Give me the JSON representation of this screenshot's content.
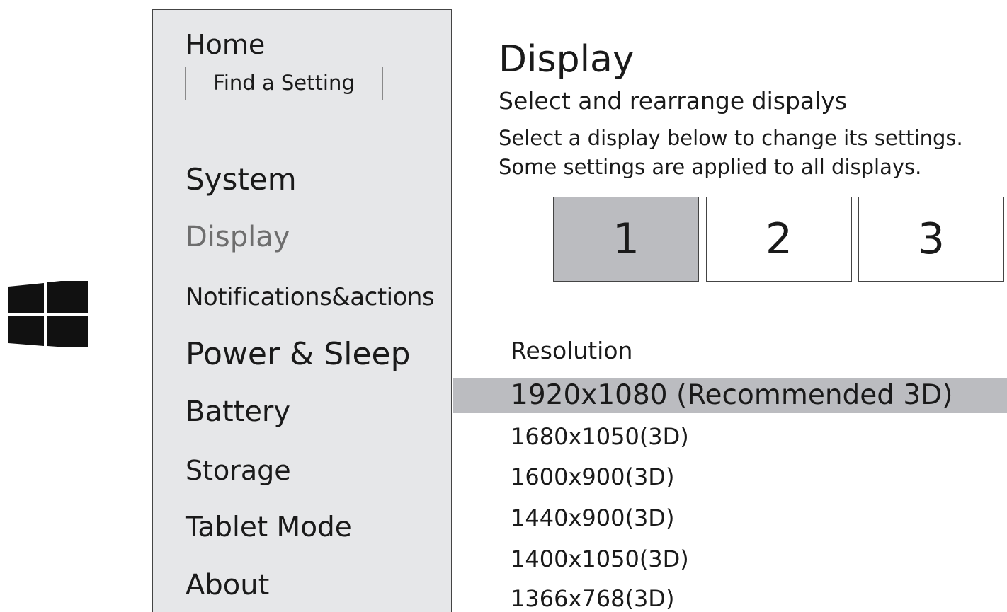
{
  "sidebar": {
    "home": "Home",
    "search_placeholder": "Find a Setting",
    "section": "System",
    "items": [
      {
        "label": "Display",
        "active": true
      },
      {
        "label": "Notifications&actions"
      },
      {
        "label": "Power & Sleep"
      },
      {
        "label": "Battery"
      },
      {
        "label": "Storage"
      },
      {
        "label": "Tablet Mode"
      },
      {
        "label": "About"
      }
    ]
  },
  "main": {
    "title": "Display",
    "subtitle": "Select and rearrange dispalys",
    "description_line1": "Select a display below to change its settings.",
    "description_line2": "Some settings are applied to all displays.",
    "monitors": [
      {
        "label": "1",
        "selected": true
      },
      {
        "label": "2"
      },
      {
        "label": "3"
      }
    ],
    "resolution": {
      "label": "Resolution",
      "selected": "1920x1080 (Recommended 3D)",
      "options": [
        "1680x1050(3D)",
        "1600x900(3D)",
        "1440x900(3D)",
        "1400x1050(3D)",
        "1366x768(3D)"
      ]
    }
  },
  "colors": {
    "sidebar_bg": "#e6e7e9",
    "selected_bg": "#bbbcc0",
    "inactive_text": "#6e6e6e"
  },
  "icons": [
    "windows-logo-icon"
  ]
}
